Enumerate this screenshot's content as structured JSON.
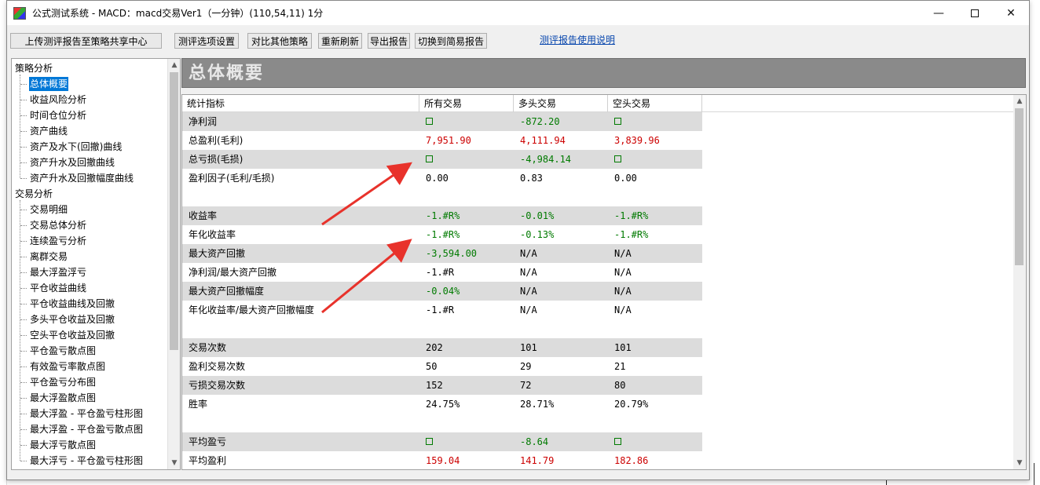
{
  "window": {
    "title": "公式测试系统 - MACD：macd交易Ver1（一分钟）(110,54,11) 1分"
  },
  "toolbar": {
    "upload_label": "上传测评报告至策略共享中心",
    "options_label": "测评选项设置",
    "compare_label": "对比其他策略",
    "refresh_label": "重新刷新",
    "export_label": "导出报告",
    "switch_label": "切换到简易报告",
    "help_link": "测评报告使用说明"
  },
  "tree": {
    "categories": [
      {
        "label": "策略分析",
        "items": [
          "总体概要",
          "收益风险分析",
          "时间仓位分析",
          "资产曲线",
          "资产及水下(回撤)曲线",
          "资产升水及回撤曲线",
          "资产升水及回撤幅度曲线"
        ]
      },
      {
        "label": "交易分析",
        "items": [
          "交易明细",
          "交易总体分析",
          "连续盈亏分析",
          "离群交易",
          "最大浮盈浮亏",
          "平仓收益曲线",
          "平仓收益曲线及回撤",
          "多头平仓收益及回撤",
          "空头平仓收益及回撤",
          "平仓盈亏散点图",
          "有效盈亏率散点图",
          "平仓盈亏分布图",
          "最大浮盈散点图",
          "最大浮盈 - 平仓盈亏柱形图",
          "最大浮盈 - 平仓盈亏散点图",
          "最大浮亏散点图",
          "最大浮亏 - 平仓盈亏柱形图"
        ]
      }
    ],
    "selected": "总体概要"
  },
  "report": {
    "banner": "总体概要",
    "columns": [
      "统计指标",
      "所有交易",
      "多头交易",
      "空头交易"
    ],
    "rows": [
      {
        "label": "净利润",
        "all": "",
        "long": "-872.20",
        "short": "",
        "gray": true,
        "colors": [
          "green",
          "green",
          "green"
        ],
        "squares": [
          true,
          false,
          true
        ]
      },
      {
        "label": "总盈利(毛利)",
        "all": "7,951.90",
        "long": "4,111.94",
        "short": "3,839.96",
        "gray": false,
        "colors": [
          "red",
          "red",
          "red"
        ],
        "squares": [
          false,
          false,
          false
        ]
      },
      {
        "label": "总亏损(毛损)",
        "all": "",
        "long": "-4,984.14",
        "short": "",
        "gray": true,
        "colors": [
          "green",
          "green",
          "green"
        ],
        "squares": [
          true,
          false,
          true
        ]
      },
      {
        "label": "盈利因子(毛利/毛损)",
        "all": "0.00",
        "long": "0.83",
        "short": "0.00",
        "gray": false,
        "colors": [
          "",
          "",
          ""
        ],
        "squares": [
          false,
          false,
          false
        ]
      },
      {
        "label": "",
        "all": "",
        "long": "",
        "short": "",
        "gray": false,
        "colors": [
          "",
          "",
          ""
        ],
        "squares": [
          false,
          false,
          false
        ]
      },
      {
        "label": "收益率",
        "all": "-1.#R%",
        "long": "-0.01%",
        "short": "-1.#R%",
        "gray": true,
        "colors": [
          "green",
          "green",
          "green"
        ],
        "squares": [
          false,
          false,
          false
        ]
      },
      {
        "label": "年化收益率",
        "all": "-1.#R%",
        "long": "-0.13%",
        "short": "-1.#R%",
        "gray": false,
        "colors": [
          "green",
          "green",
          "green"
        ],
        "squares": [
          false,
          false,
          false
        ]
      },
      {
        "label": "最大资产回撤",
        "all": "-3,594.00",
        "long": "N/A",
        "short": "N/A",
        "gray": true,
        "colors": [
          "green",
          "",
          ""
        ],
        "squares": [
          false,
          false,
          false
        ]
      },
      {
        "label": "净利润/最大资产回撤",
        "all": "-1.#R",
        "long": "N/A",
        "short": "N/A",
        "gray": false,
        "colors": [
          "",
          "",
          ""
        ],
        "squares": [
          false,
          false,
          false
        ]
      },
      {
        "label": "最大资产回撤幅度",
        "all": "-0.04%",
        "long": "N/A",
        "short": "N/A",
        "gray": true,
        "colors": [
          "green",
          "",
          ""
        ],
        "squares": [
          false,
          false,
          false
        ]
      },
      {
        "label": "年化收益率/最大资产回撤幅度",
        "all": "-1.#R",
        "long": "N/A",
        "short": "N/A",
        "gray": false,
        "colors": [
          "",
          "",
          ""
        ],
        "squares": [
          false,
          false,
          false
        ]
      },
      {
        "label": "",
        "all": "",
        "long": "",
        "short": "",
        "gray": false,
        "colors": [
          "",
          "",
          ""
        ],
        "squares": [
          false,
          false,
          false
        ]
      },
      {
        "label": "交易次数",
        "all": "202",
        "long": "101",
        "short": "101",
        "gray": true,
        "colors": [
          "",
          "",
          ""
        ],
        "squares": [
          false,
          false,
          false
        ]
      },
      {
        "label": "盈利交易次数",
        "all": "50",
        "long": "29",
        "short": "21",
        "gray": false,
        "colors": [
          "",
          "",
          ""
        ],
        "squares": [
          false,
          false,
          false
        ]
      },
      {
        "label": "亏损交易次数",
        "all": "152",
        "long": "72",
        "short": "80",
        "gray": true,
        "colors": [
          "",
          "",
          ""
        ],
        "squares": [
          false,
          false,
          false
        ]
      },
      {
        "label": "胜率",
        "all": "24.75%",
        "long": "28.71%",
        "short": "20.79%",
        "gray": false,
        "colors": [
          "",
          "",
          ""
        ],
        "squares": [
          false,
          false,
          false
        ]
      },
      {
        "label": "",
        "all": "",
        "long": "",
        "short": "",
        "gray": false,
        "colors": [
          "",
          "",
          ""
        ],
        "squares": [
          false,
          false,
          false
        ]
      },
      {
        "label": "平均盈亏",
        "all": "",
        "long": "-8.64",
        "short": "",
        "gray": true,
        "colors": [
          "green",
          "green",
          "green"
        ],
        "squares": [
          true,
          false,
          true
        ]
      },
      {
        "label": "平均盈利",
        "all": "159.04",
        "long": "141.79",
        "short": "182.86",
        "gray": false,
        "colors": [
          "red",
          "red",
          "red"
        ],
        "squares": [
          false,
          false,
          false
        ]
      }
    ]
  },
  "colors": {
    "selection": "#0078d7",
    "banner": "#8a8a8a",
    "positive": "#cc0000",
    "negative": "#007a00",
    "annotation_arrow": "#e8322b"
  }
}
